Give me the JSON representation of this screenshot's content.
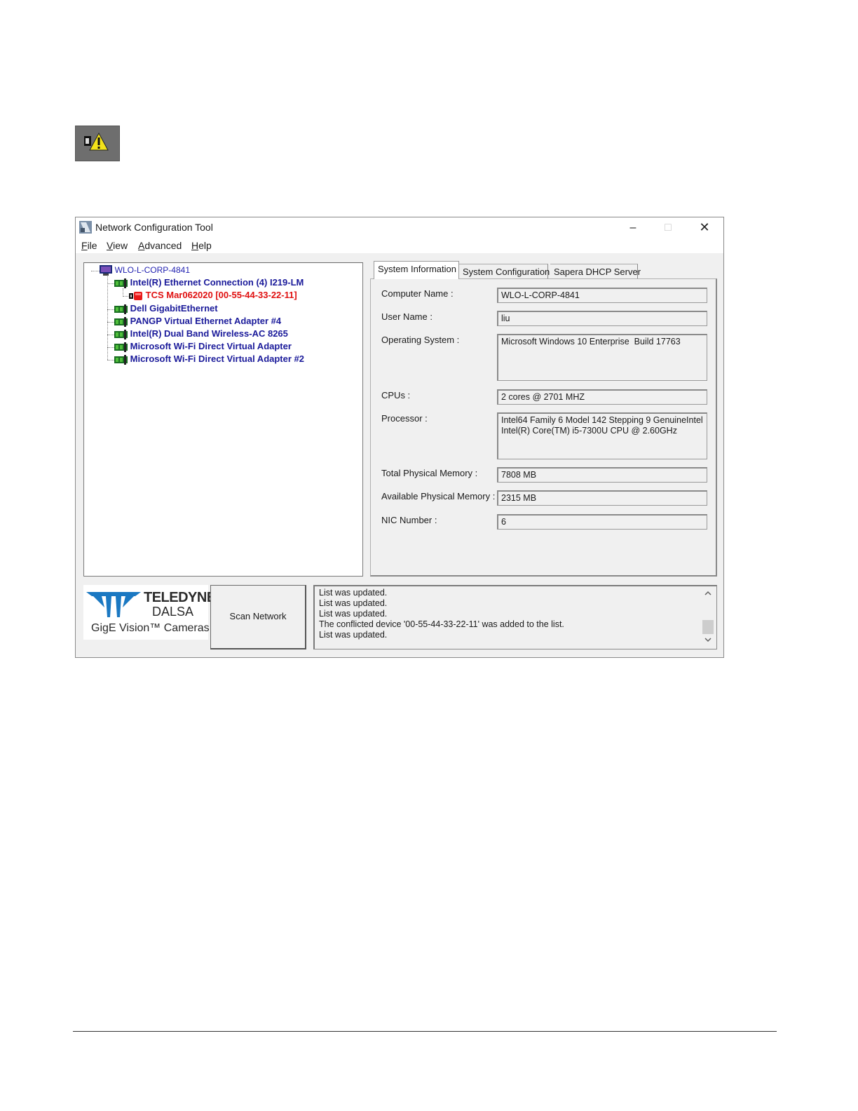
{
  "window": {
    "title": "Network Configuration Tool",
    "controls": {
      "minimize": "–",
      "maximize": "□",
      "close": "✕"
    }
  },
  "menu": [
    {
      "label": "File",
      "accel": "F",
      "rest": "ile"
    },
    {
      "label": "View",
      "accel": "V",
      "rest": "iew"
    },
    {
      "label": "Advanced",
      "accel": "A",
      "rest": "dvanced"
    },
    {
      "label": "Help",
      "accel": "H",
      "rest": "elp"
    }
  ],
  "tree": {
    "root": "WLO-L-CORP-4841",
    "adapters": [
      "Intel(R) Ethernet Connection (4) I219-LM",
      "Dell GigabitEthernet",
      "PANGP Virtual Ethernet Adapter #4",
      "Intel(R) Dual Band Wireless-AC 8265",
      "Microsoft Wi-Fi Direct Virtual Adapter",
      "Microsoft Wi-Fi Direct Virtual Adapter #2"
    ],
    "conflicted_device": "TCS Mar062020 [00-55-44-33-22-11]"
  },
  "tabs": [
    "System Information",
    "System Configuration",
    "Sapera DHCP Server"
  ],
  "system_info": {
    "computer_name": {
      "label": "Computer Name :",
      "value": "WLO-L-CORP-4841"
    },
    "user_name": {
      "label": "User Name :",
      "value": "liu"
    },
    "os": {
      "label": "Operating System :",
      "value": "Microsoft Windows 10 Enterprise  Build 17763"
    },
    "cpus": {
      "label": "CPUs :",
      "value": "2 cores @ 2701 MHZ"
    },
    "processor": {
      "label": "Processor :",
      "line1": "Intel64 Family 6 Model 142 Stepping 9 GenuineIntel",
      "line2": "Intel(R) Core(TM) i5-7300U CPU @ 2.60GHz"
    },
    "total_mem": {
      "label": "Total Physical Memory :",
      "value": "7808 MB"
    },
    "avail_mem": {
      "label": "Available Physical Memory :",
      "value": "2315 MB"
    },
    "nic_number": {
      "label": "NIC Number :",
      "value": "6"
    }
  },
  "logo": {
    "brand": "TELEDYNE",
    "sub": "DALSA",
    "tagline": "GigE Vision™ Cameras"
  },
  "scan_button": "Scan Network",
  "log": [
    "List was updated.",
    "List was updated.",
    "List was updated.",
    "The conflicted device '00-55-44-33-22-11' was added to the list.",
    "List was updated."
  ],
  "colors": {
    "tree_blue": "#1a1a9a",
    "conflict_red": "#e01010",
    "logo_blue": "#1a78c2"
  }
}
